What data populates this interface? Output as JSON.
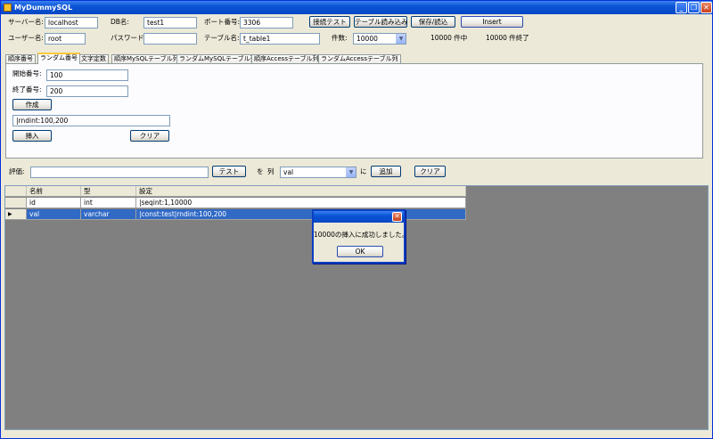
{
  "window": {
    "title": "MyDummySQL",
    "minimize": "_",
    "maximize": "❐",
    "close": "✕"
  },
  "connection": {
    "server_label": "サーバー名:",
    "server_value": "localhost",
    "db_label": "DB名:",
    "db_value": "test1",
    "port_label": "ポート番号:",
    "port_value": "3306",
    "user_label": "ユーザー名:",
    "user_value": "root",
    "password_label": "パスワード:",
    "password_value": "",
    "table_label": "テーブル名:",
    "table_value": "t_table1",
    "count_label": "件数:",
    "count_value": "10000",
    "progress_text": "10000 件中",
    "done_text": "10000 件終了"
  },
  "toolbar": {
    "test_connection": "接続テスト",
    "load_table": "テーブル読み込み",
    "save_load": "保存/読込",
    "insert": "Insert"
  },
  "tabs": [
    "順序番号",
    "ランダム番号",
    "文字定数",
    "順序MySQLテーブル列",
    "ランダムMySQLテーブル列",
    "順序Accessテーブル列",
    "ランダムAccessテーブル列"
  ],
  "panel": {
    "start_label": "開始番号:",
    "start_value": "100",
    "end_label": "終了番号:",
    "end_value": "200",
    "create_button": "作成",
    "expression": "|rndint:100,200",
    "insert_button": "挿入",
    "clear_button": "クリア"
  },
  "evaluate": {
    "label": "評価:",
    "value": "",
    "test_button": "テスト",
    "wo": "を",
    "column_label": "列",
    "column_value": "val",
    "ni": "に",
    "add_button": "追加",
    "clear_button": "クリア"
  },
  "grid": {
    "headers": [
      "名前",
      "型",
      "設定"
    ],
    "rows": [
      {
        "name": "id",
        "type": "int",
        "setting": "|seqint:1,10000"
      },
      {
        "name": "val",
        "type": "varchar",
        "setting": "|const:test|rndint:100,200"
      }
    ],
    "row_indicator": "▶"
  },
  "dialog": {
    "message": "10000の挿入に成功しました。",
    "ok_button": "OK",
    "close": "✕"
  }
}
